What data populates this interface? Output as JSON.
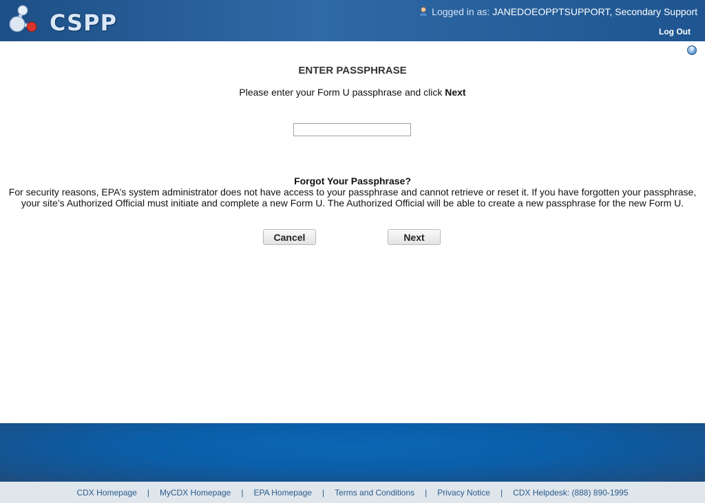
{
  "header": {
    "app_name": "CSPP",
    "logged_in_prefix": "Logged in as:",
    "user_name": "JANEDOEOPPTSUPPORT, Secondary Support",
    "logout_label": "Log Out"
  },
  "main": {
    "title": "ENTER PASSPHRASE",
    "instruction_prefix": "Please enter your Form U passphrase and click",
    "instruction_bold": "Next",
    "passphrase_value": "",
    "forgot_title": "Forgot Your Passphrase?",
    "forgot_text": "For security reasons, EPA’s system administrator does not have access to your passphrase and cannot retrieve or reset it. If you have forgotten your passphrase, your site’s Authorized Official must initiate and complete a new Form U. The Authorized Official will be able to create a new passphrase for the new Form U.",
    "cancel_label": "Cancel",
    "next_label": "Next"
  },
  "footer": {
    "links": [
      "CDX Homepage",
      "MyCDX Homepage",
      "EPA Homepage",
      "Terms and Conditions",
      "Privacy Notice",
      "CDX Helpdesk: (888) 890-1995"
    ],
    "separator": "|"
  },
  "icons": {
    "logo": "molecule-logo-icon",
    "user": "user-icon",
    "help": "help-icon"
  }
}
